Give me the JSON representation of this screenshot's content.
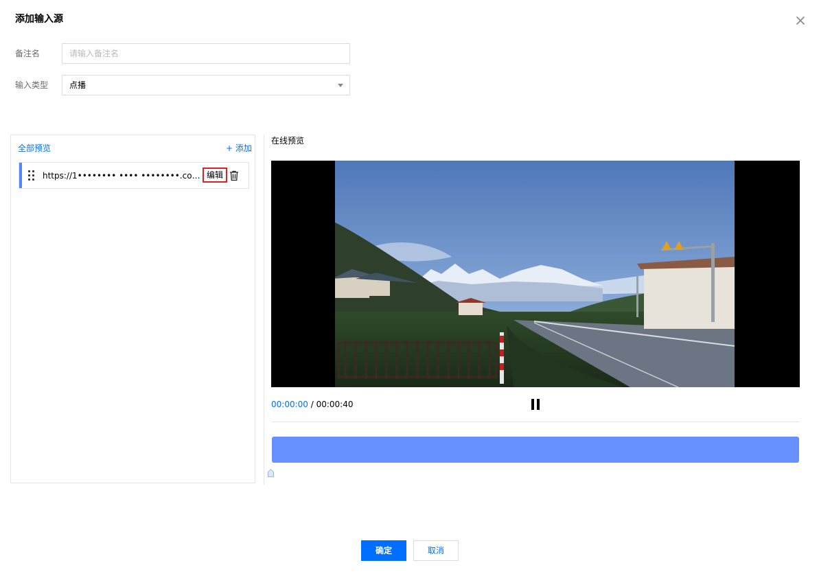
{
  "dialog": {
    "title": "添加输入源",
    "close_icon": "close-icon"
  },
  "form": {
    "alias": {
      "label": "备注名",
      "value": "",
      "placeholder": "请输入备注名"
    },
    "input_type": {
      "label": "输入类型",
      "value": "点播",
      "icon": "chevron-down-icon"
    }
  },
  "source_list": {
    "all_preview_label": "全部预览",
    "add_label": "+ 添加",
    "items": [
      {
        "url": "https://1•••••••• •••• ••••••••.com/...",
        "edit_label": "编辑",
        "drag_icon": "drag-handle-icon",
        "delete_icon": "trash-icon"
      }
    ]
  },
  "preview": {
    "title": "在线预览",
    "current_time": "00:00:00",
    "separator": " / ",
    "total_time": "00:00:40",
    "state_icon": "pause-icon"
  },
  "timeline": {
    "track_color": "#6690ff",
    "playhead_position": 0
  },
  "footer": {
    "confirm_label": "确定",
    "cancel_label": "取消"
  },
  "colors": {
    "accent": "#006eff",
    "edit_highlight": "#e02020",
    "item_bar": "#5585ff"
  }
}
